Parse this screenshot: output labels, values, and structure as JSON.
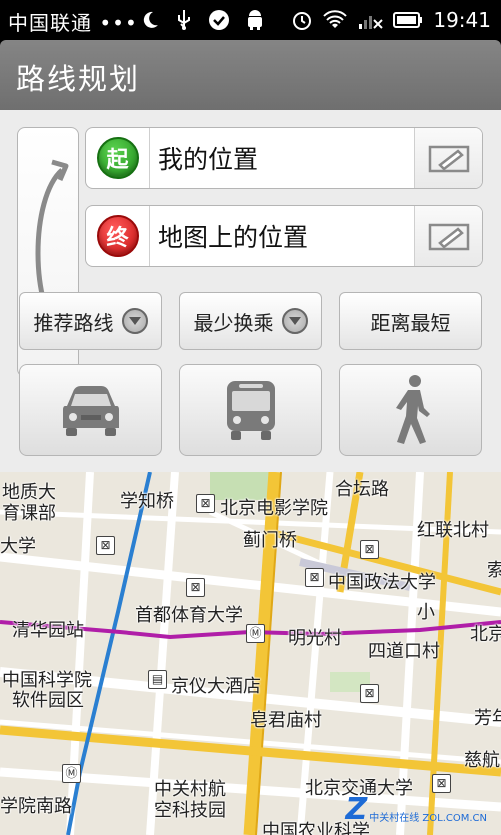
{
  "status_bar": {
    "carrier": "中国联通 •••",
    "time": "19:41"
  },
  "header": {
    "title": "路线规划"
  },
  "route": {
    "start_badge": "起",
    "start_text": "我的位置",
    "end_badge": "终",
    "end_text": "地图上的位置"
  },
  "options": {
    "recommended": "推荐路线",
    "least_transfer": "最少换乘",
    "shortest": "距离最短"
  },
  "modes": [
    {
      "name": "car",
      "icon": "car-icon"
    },
    {
      "name": "bus",
      "icon": "bus-icon"
    },
    {
      "name": "walk",
      "icon": "walk-icon"
    }
  ],
  "map": {
    "labels": {
      "l1": "地质大",
      "l2": "育课部",
      "l3": "学知桥",
      "l4": "北京电影学院",
      "l5": "合坛路",
      "l6": "蓟门桥",
      "l7": "红联北村",
      "l8": "大学",
      "l9": "中国政法大学",
      "l10": "首都体育大学",
      "l11": "小",
      "l12": "清华园站",
      "l13": "明光村",
      "l14": "北京",
      "l15": "四道口村",
      "l16": "中国科学院",
      "l17": "软件园区",
      "l18": "京仪大酒店",
      "l19": "皂君庙村",
      "l20": "芳年",
      "l21": "慈航",
      "l22": "学院南路",
      "l23": "中关村航",
      "l24": "空科技园",
      "l25": "北京交通大学",
      "l26": "中国农业科学",
      "l27": "索"
    },
    "watermark": "中关村在线 ZOL.COM.CN"
  },
  "colors": {
    "start_green": "#1e8c1a",
    "end_red": "#c40f0f",
    "subway_purple": "#b01ea8",
    "road_yellow": "#f3c537",
    "subway_blue": "#2a7fd1"
  }
}
